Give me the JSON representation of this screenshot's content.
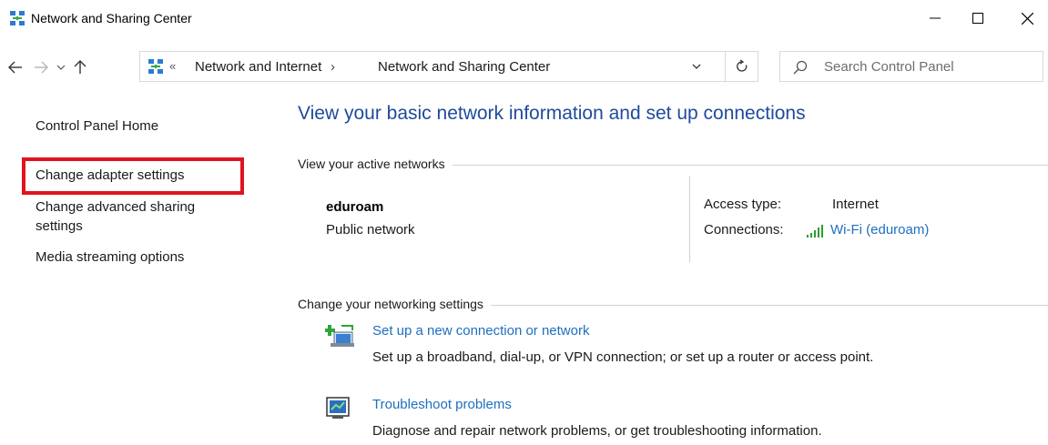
{
  "window": {
    "title": "Network and Sharing Center"
  },
  "address_bar": {
    "overflow_chevrons": "«",
    "crumbs": [
      "Network and Internet",
      "Network and Sharing Center"
    ],
    "separator": "›"
  },
  "search": {
    "placeholder": "Search Control Panel"
  },
  "sidebar": {
    "items": [
      "Control Panel Home",
      "Change adapter settings",
      "Change advanced sharing settings",
      "Media streaming options"
    ],
    "highlighted_item": "Change adapter settings",
    "highlight_color": "#e0141e"
  },
  "main": {
    "title": "View your basic network information and set up connections",
    "active_networks_label": "View your active networks",
    "network": {
      "name": "eduroam",
      "type": "Public network",
      "access_type_label": "Access type:",
      "access_type_value": "Internet",
      "connections_label": "Connections:",
      "connections_value": "Wi-Fi (eduroam)",
      "connections_icon": "wifi-signal-icon"
    },
    "change_settings_label": "Change your networking settings",
    "tasks": [
      {
        "icon": "new-connection-icon",
        "link": "Set up a new connection or network",
        "description": "Set up a broadband, dial-up, or VPN connection; or set up a router or access point."
      },
      {
        "icon": "troubleshoot-icon",
        "link": "Troubleshoot problems",
        "description": "Diagnose and repair network problems, or get troubleshooting information."
      }
    ]
  },
  "colors": {
    "title_blue": "#1e4b9b",
    "link_blue": "#1e6fbf"
  }
}
